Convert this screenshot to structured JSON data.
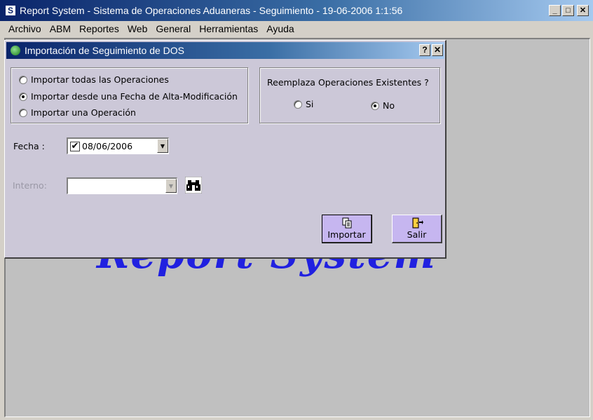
{
  "window": {
    "title": "Report System - Sistema de Operaciones Aduaneras - Seguimiento - 19-06-2006 1:1:56",
    "icon_letter": "S",
    "minimize": "_",
    "maximize": "□",
    "close": "✕"
  },
  "menu": [
    "Archivo",
    "ABM",
    "Reportes",
    "Web",
    "General",
    "Herramientas",
    "Ayuda"
  ],
  "watermark": "Report System",
  "dialog": {
    "title": "Importación de Seguimiento de DOS",
    "help": "?",
    "close": "✕",
    "import_options": [
      {
        "label": "Importar todas las Operaciones",
        "checked": false
      },
      {
        "label": "Importar desde una Fecha de Alta-Modificación",
        "checked": true
      },
      {
        "label": "Importar una Operación",
        "checked": false
      }
    ],
    "replace": {
      "question": "Reemplaza Operaciones Existentes ?",
      "si": "Si",
      "no": "No",
      "selected": "No"
    },
    "fecha_label": "Fecha :",
    "fecha_value": "08/06/2006",
    "fecha_checked": "✔",
    "interno_label": "Interno:",
    "interno_value": "",
    "importar_button": "Importar",
    "salir_button": "Salir",
    "colors": {
      "button_face": "#c6b6f0",
      "dialog_bg": "#ccc8d8",
      "watermark": "#2020e0"
    }
  }
}
